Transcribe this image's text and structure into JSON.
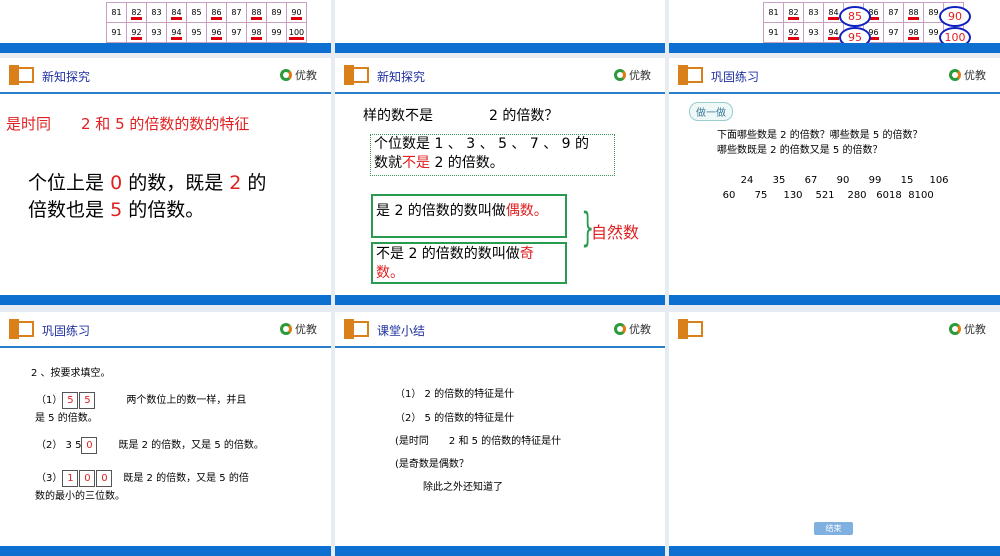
{
  "top_table": {
    "row1": [
      "81",
      "82",
      "83",
      "84",
      "85",
      "86",
      "87",
      "88",
      "89",
      "90"
    ],
    "row2": [
      "91",
      "92",
      "93",
      "94",
      "95",
      "96",
      "97",
      "98",
      "99",
      "100"
    ]
  },
  "circled": [
    "85",
    "95",
    "90",
    "100"
  ],
  "logo_text": "优教",
  "slides": {
    "s4": {
      "title": "新知探究",
      "line1": "是时同　　2 和 5 的倍数的数的特征",
      "p1": "个位上是",
      "p2": "0",
      "p3": "的数，既是",
      "p4": "2",
      "p5": "的",
      "p6": "倍数也是",
      "p7": "5",
      "p8": "的倍数。"
    },
    "s5": {
      "title": "新知探究",
      "q": "样的数不是　　　　2 的倍数？",
      "box1a": "个位数是 1 、 3 、 5 、 7 、 9 的",
      "box1b": "数就",
      "box1c": "不是",
      "box1d": "2 的倍数。",
      "even_a": "是 2 的倍数的数叫做",
      "even_b": "偶数。",
      "odd_a": "不是 2 的倍数的数叫做",
      "odd_b": "奇",
      "odd_c": "数。",
      "natural": "自然数"
    },
    "s6": {
      "title": "巩固练习",
      "tag": "做一做",
      "q1": "下面哪些数是 2 的倍数？哪些数是 5 的倍数？",
      "q2": "哪些数既是 2 的倍数又是 5 的倍数？",
      "nums1": [
        "24",
        "35",
        "67",
        "90",
        "99",
        "15",
        "106"
      ],
      "nums2": [
        "60",
        "75",
        "130",
        "521",
        "280",
        "6018",
        "8100"
      ]
    },
    "s7": {
      "title": "巩固练习",
      "heading": "2 、按要求填空。",
      "i1": "（1）",
      "i1_boxes": [
        "5",
        "5"
      ],
      "i1_text": "两个数位上的数一样，并且",
      "i1_text2": "是 5 的倍数。",
      "i2": "（2） 3 5",
      "i2_box": "0",
      "i2_text": "既是 2 的倍数，又是 5 的倍数。",
      "i3": "（3）",
      "i3_boxes": [
        "1",
        "0",
        "0"
      ],
      "i3_text": "既是 2 的倍数，又是 5 的倍",
      "i3_text2": "数的最小的三位数。"
    },
    "s8": {
      "title": "课堂小结",
      "lines": [
        "（1） 2 的倍数的特征是什",
        "（2） 5 的倍数的特征是什",
        "(是时同　　2 和 5 的倍数的特征是什",
        "(是奇数是偶数？",
        "除此之外还知道了"
      ]
    },
    "s9": {
      "end_button": "结束"
    }
  }
}
